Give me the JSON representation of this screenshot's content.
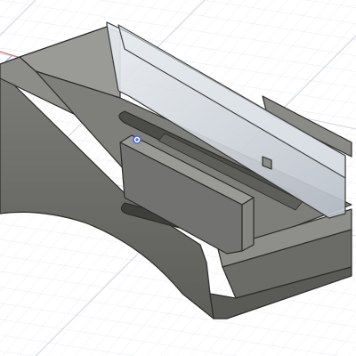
{
  "app": {
    "view": "3d-model-viewport",
    "object": "slotted-housing-body",
    "selected_point_marker": "point-marker-icon"
  },
  "colors": {
    "background": "#ffffff",
    "grid_minor": "#dfe5ec",
    "grid_major": "#c4ccd6",
    "axis_red": "#e07070",
    "axis_blue": "#9fb0d6",
    "body_top": "#8a8a86",
    "body_side": "#6f6f6b",
    "body_dark": "#54544f",
    "glass": "#cfd5dc",
    "edge": "#2c2c2a",
    "marker": "#4a66d6"
  }
}
